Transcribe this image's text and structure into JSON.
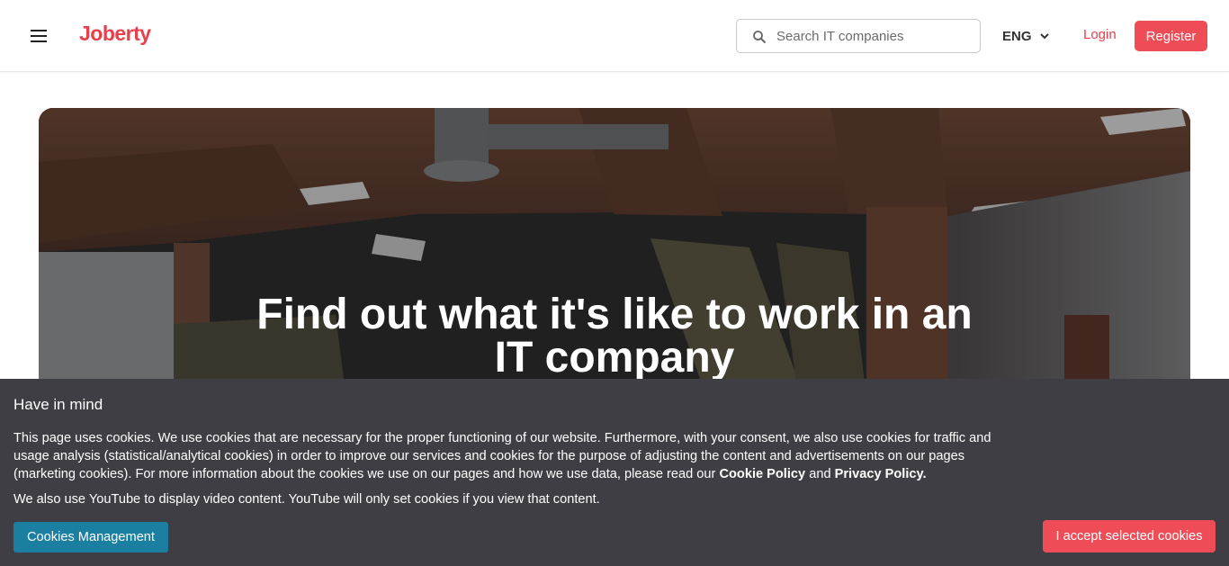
{
  "header": {
    "logo": "Joberty",
    "search_placeholder": "Search IT companies",
    "language": "ENG",
    "login_label": "Login",
    "register_label": "Register",
    "accent_color": "#e8404a"
  },
  "hero": {
    "title": "Find out what it's like to work in an IT company"
  },
  "cookie_banner": {
    "heading": "Have in mind",
    "text_main": "This page uses cookies. We use cookies that are necessary for the proper functioning of our website. Furthermore, with your consent, we also use cookies for traffic and usage analysis (statistical/analytical cookies) in order to improve our services and cookies for the purpose of adjusting the content and advertisements on our pages (marketing cookies). For more information about the cookies we use on our pages and how we use data, please read our ",
    "cookie_policy_link": "Cookie Policy",
    "and_text": " and ",
    "privacy_policy_link": "Privacy Policy.",
    "text_youtube": "We also use YouTube to display video content. YouTube will only set cookies if you view that content.",
    "manage_label": "Cookies Management",
    "accept_label": "I accept selected cookies",
    "background_color": "#3f3e44",
    "manage_color": "#1a7fa0",
    "accept_color": "#ee4d57"
  }
}
